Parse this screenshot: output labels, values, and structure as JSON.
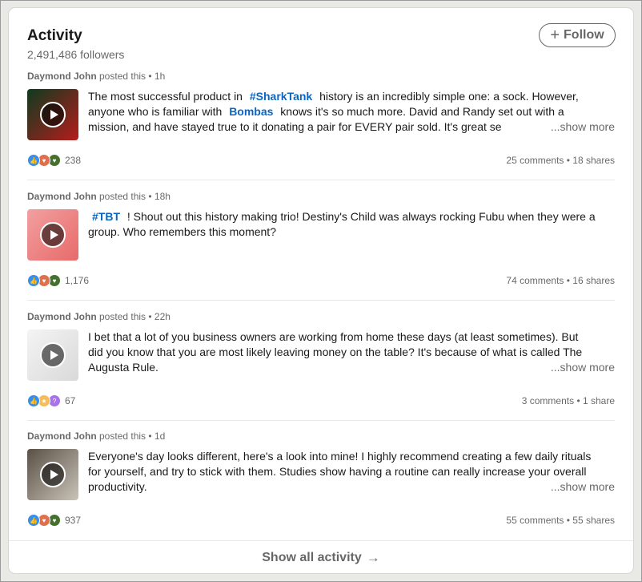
{
  "header": {
    "title": "Activity",
    "followers": "2,491,486 followers",
    "follow_label": "Follow"
  },
  "posts": [
    {
      "author": "Daymond John",
      "action": " posted this • ",
      "time": "1h",
      "lines": [
        [
          "The most successful product in ",
          "#SharkTank",
          " history is an incredibly simple one: a sock. However,"
        ],
        [
          "anyone who is familiar with ",
          "Bombas",
          " knows it's so much more. David and Randy set out with a"
        ],
        [
          "mission, and have stayed true to it donating a pair for EVERY pair sold. It's great se",
          "",
          ""
        ]
      ],
      "more": "...show more",
      "reactions": [
        "like",
        "love",
        "support"
      ],
      "reaction_count": "238",
      "comments_shares": "25 comments • 18 shares",
      "thumb_colors": [
        "#0d3b1e",
        "#b61d1d"
      ]
    },
    {
      "author": "Daymond John",
      "action": " posted this • ",
      "time": "18h",
      "lines": [
        [
          "",
          "#TBT",
          " ! Shout out this history making trio! Destiny's Child was always rocking Fubu when they were a"
        ],
        [
          "group. Who remembers this moment?",
          "",
          ""
        ]
      ],
      "more": "",
      "reactions": [
        "like",
        "love",
        "support"
      ],
      "reaction_count": "1,176",
      "comments_shares": "74 comments • 16 shares",
      "thumb_colors": [
        "#f2a0a0",
        "#e86a6a"
      ]
    },
    {
      "author": "Daymond John",
      "action": " posted this • ",
      "time": "22h",
      "lines": [
        [
          "I bet that a lot of you business owners are working from home these days (at least sometimes). But",
          "",
          ""
        ],
        [
          "did you know that you are most likely leaving money on the table? It's because of what is called The",
          "",
          ""
        ],
        [
          "Augusta Rule.",
          "",
          ""
        ]
      ],
      "more": "...show more",
      "reactions": [
        "like",
        "insightful",
        "curious"
      ],
      "reaction_count": "67",
      "comments_shares": "3 comments • 1 share",
      "thumb_colors": [
        "#f4f4f4",
        "#d9d9d9"
      ]
    },
    {
      "author": "Daymond John",
      "action": " posted this • ",
      "time": "1d",
      "lines": [
        [
          "Everyone's day looks different, here's a look into mine! I highly recommend creating a few daily rituals",
          "",
          ""
        ],
        [
          "for yourself, and try to stick with them. Studies show having a routine can really increase your overall",
          "",
          ""
        ],
        [
          "productivity.",
          "",
          ""
        ]
      ],
      "more": "...show more",
      "reactions": [
        "like",
        "love",
        "support"
      ],
      "reaction_count": "937",
      "comments_shares": "55 comments • 55 shares",
      "thumb_colors": [
        "#5a5046",
        "#c9c3b8"
      ]
    }
  ],
  "footer": {
    "show_all": "Show all activity",
    "arrow": "→"
  }
}
